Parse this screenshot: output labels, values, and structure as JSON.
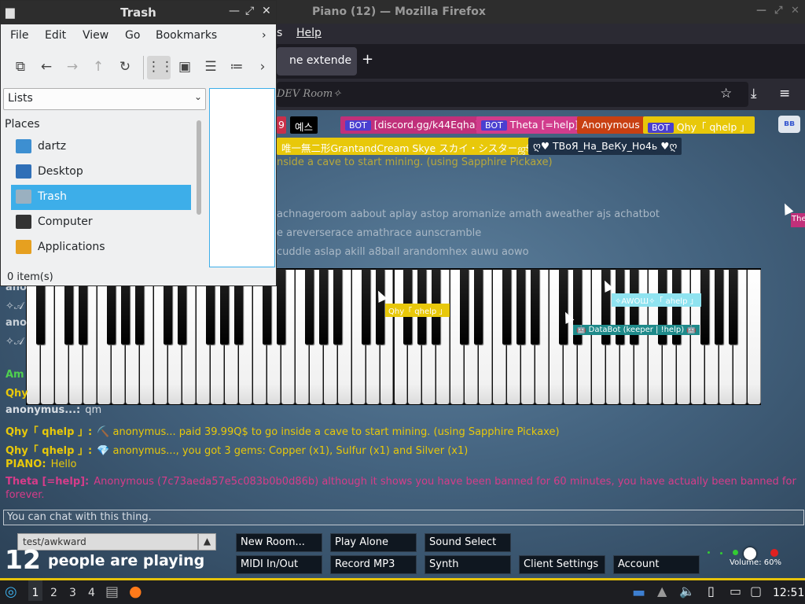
{
  "firefox": {
    "window_title": "Piano (12) — Mozilla Firefox",
    "menu": [
      "s",
      "Help"
    ],
    "tab_label": "ne extende",
    "url_text": "DEV Room✧"
  },
  "piano": {
    "user_tags": {
      "room": "9",
      "yeseu": "예스",
      "discord": "[discord.gg/k44Eqha]",
      "bot_badge": "BOT",
      "theta": "Theta [=help]",
      "anon": "Anonymous",
      "qhy": "Qhy「 qhelp 」",
      "grant": "唯一無二形GrantandCream Skye スカイ・シスターஜூ",
      "tvoya": "ღ♥ ТВоЯ_На_ВеКу_Но4ь ♥ღ",
      "side": "The"
    },
    "mode_button": "вв",
    "ghost_lines": [
      "nside a cave to start mining. (using Sapphire Pickaxe)",
      "achnageroom aabout aplay astop aromanize amath aweather ajs achatbot",
      "e areverserace amathrace aunscramble",
      "cuddle aslap akill a8ball arandomhex auwu aowo"
    ],
    "left_fragments": [
      "ano",
      "✧𝒜",
      "ano",
      "✧𝒜",
      "Am",
      "Qhy"
    ],
    "cursor_tags": {
      "qhy": "Qhy「 qhelp 」",
      "awo": "✧AWOШ✧「 ahelp 」",
      "databot": "🤖 DataBot (keeper | !help) 🤖"
    },
    "chat": [
      {
        "name": "anonymus...:",
        "text": "qm",
        "name_color": "#d7dde3",
        "text_color": "#d7dde3"
      },
      {
        "name": "Qhy「 qhelp 」:",
        "text": "⛏️ anonymus... paid 39.99Q$ to go inside a cave to start mining. (using Sapphire Pickaxe)",
        "name_color": "#e8c80a",
        "text_color": "#e8c80a"
      },
      {
        "name": "Qhy「 qhelp 」:",
        "text": "💎 anonymus..., you got 3 gems: Copper (x1), Sulfur (x1) and Silver (x1)",
        "name_color": "#e8c80a",
        "text_color": "#e8c80a"
      },
      {
        "name": "PIANO:",
        "text": "Hello",
        "name_color": "#e8c80a",
        "text_color": "#e8c80a"
      }
    ],
    "theta_name": "Theta [=help]:",
    "theta_message": "Anonymous (7c73aeda57e5c083b0b0d86b) although it shows you have been banned for 60 minutes, you have actually been banned for forever.",
    "chat_placeholder": "You can chat with this thing.",
    "room_name": "test/awkward",
    "players_count": "12",
    "players_label": "people are playing",
    "buttons": {
      "new_room": "New Room...",
      "play_alone": "Play Alone",
      "sound_select": "Sound Select",
      "midi": "MIDI In/Out",
      "record": "Record MP3",
      "synth": "Synth",
      "client_settings": "Client Settings",
      "account": "Account"
    },
    "volume_label": "Volume: 60%",
    "volume": 0.6
  },
  "file_manager": {
    "title": "Trash",
    "menu": [
      "File",
      "Edit",
      "View",
      "Go",
      "Bookmarks"
    ],
    "view_combo": "Lists",
    "places_label": "Places",
    "places": [
      {
        "label": "dartz",
        "icon": "home-folder-icon",
        "color": "#3d8fd1"
      },
      {
        "label": "Desktop",
        "icon": "desktop-icon",
        "color": "#2f6fb7"
      },
      {
        "label": "Trash",
        "icon": "trash-icon",
        "color": "#9ab0c0"
      },
      {
        "label": "Computer",
        "icon": "computer-icon",
        "color": "#333333"
      },
      {
        "label": "Applications",
        "icon": "applications-icon",
        "color": "#e6a020"
      }
    ],
    "status": "0 item(s)"
  },
  "taskbar": {
    "workspaces": [
      "1",
      "2",
      "3",
      "4"
    ],
    "clock": "12:51"
  },
  "colors": {
    "accent": "#3daee9",
    "taskbar_border": "#e6c30a",
    "qhy_yellow": "#e8c80a",
    "theta_pink": "#d63c8a"
  }
}
